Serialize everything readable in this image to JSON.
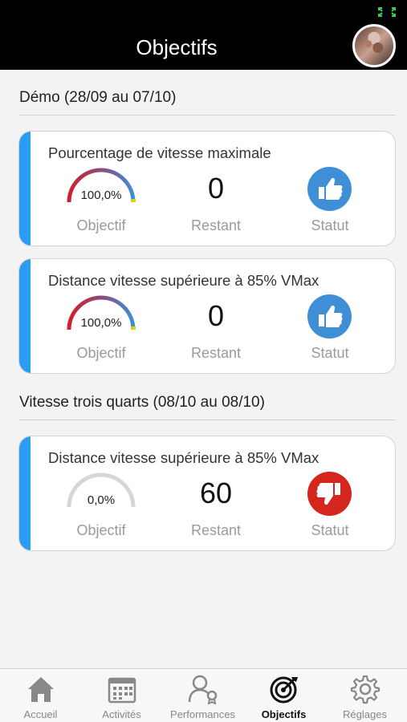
{
  "header": {
    "title": "Objectifs"
  },
  "groups": [
    {
      "title": "Démo (28/09 au 07/10)",
      "cards": [
        {
          "title": "Pourcentage de vitesse maximale",
          "gauge_value": "100,0%",
          "gauge_fraction": 1.0,
          "remaining": "0",
          "status": "thumbs-up",
          "labels": [
            "Objectif",
            "Restant",
            "Statut"
          ]
        },
        {
          "title": "Distance vitesse supérieure à 85% VMax",
          "gauge_value": "100,0%",
          "gauge_fraction": 1.0,
          "remaining": "0",
          "status": "thumbs-up",
          "labels": [
            "Objectif",
            "Restant",
            "Statut"
          ]
        }
      ]
    },
    {
      "title": "Vitesse trois quarts (08/10 au 08/10)",
      "cards": [
        {
          "title": "Distance vitesse supérieure à 85% VMax",
          "gauge_value": "0,0%",
          "gauge_fraction": 0.0,
          "remaining": "60",
          "status": "thumbs-down",
          "labels": [
            "Objectif",
            "Restant",
            "Statut"
          ]
        }
      ]
    }
  ],
  "colors": {
    "accent": "#2c9cf0",
    "status_good": "#3f8fd7",
    "status_bad": "#d3261d",
    "gauge_empty": "#d6d6d6"
  },
  "tabs": [
    {
      "label": "Accueil",
      "icon": "home-icon",
      "active": false
    },
    {
      "label": "Activités",
      "icon": "calendar-icon",
      "active": false
    },
    {
      "label": "Performances",
      "icon": "performance-icon",
      "active": false
    },
    {
      "label": "Objectifs",
      "icon": "target-icon",
      "active": true
    },
    {
      "label": "Réglages",
      "icon": "gear-icon",
      "active": false
    }
  ]
}
